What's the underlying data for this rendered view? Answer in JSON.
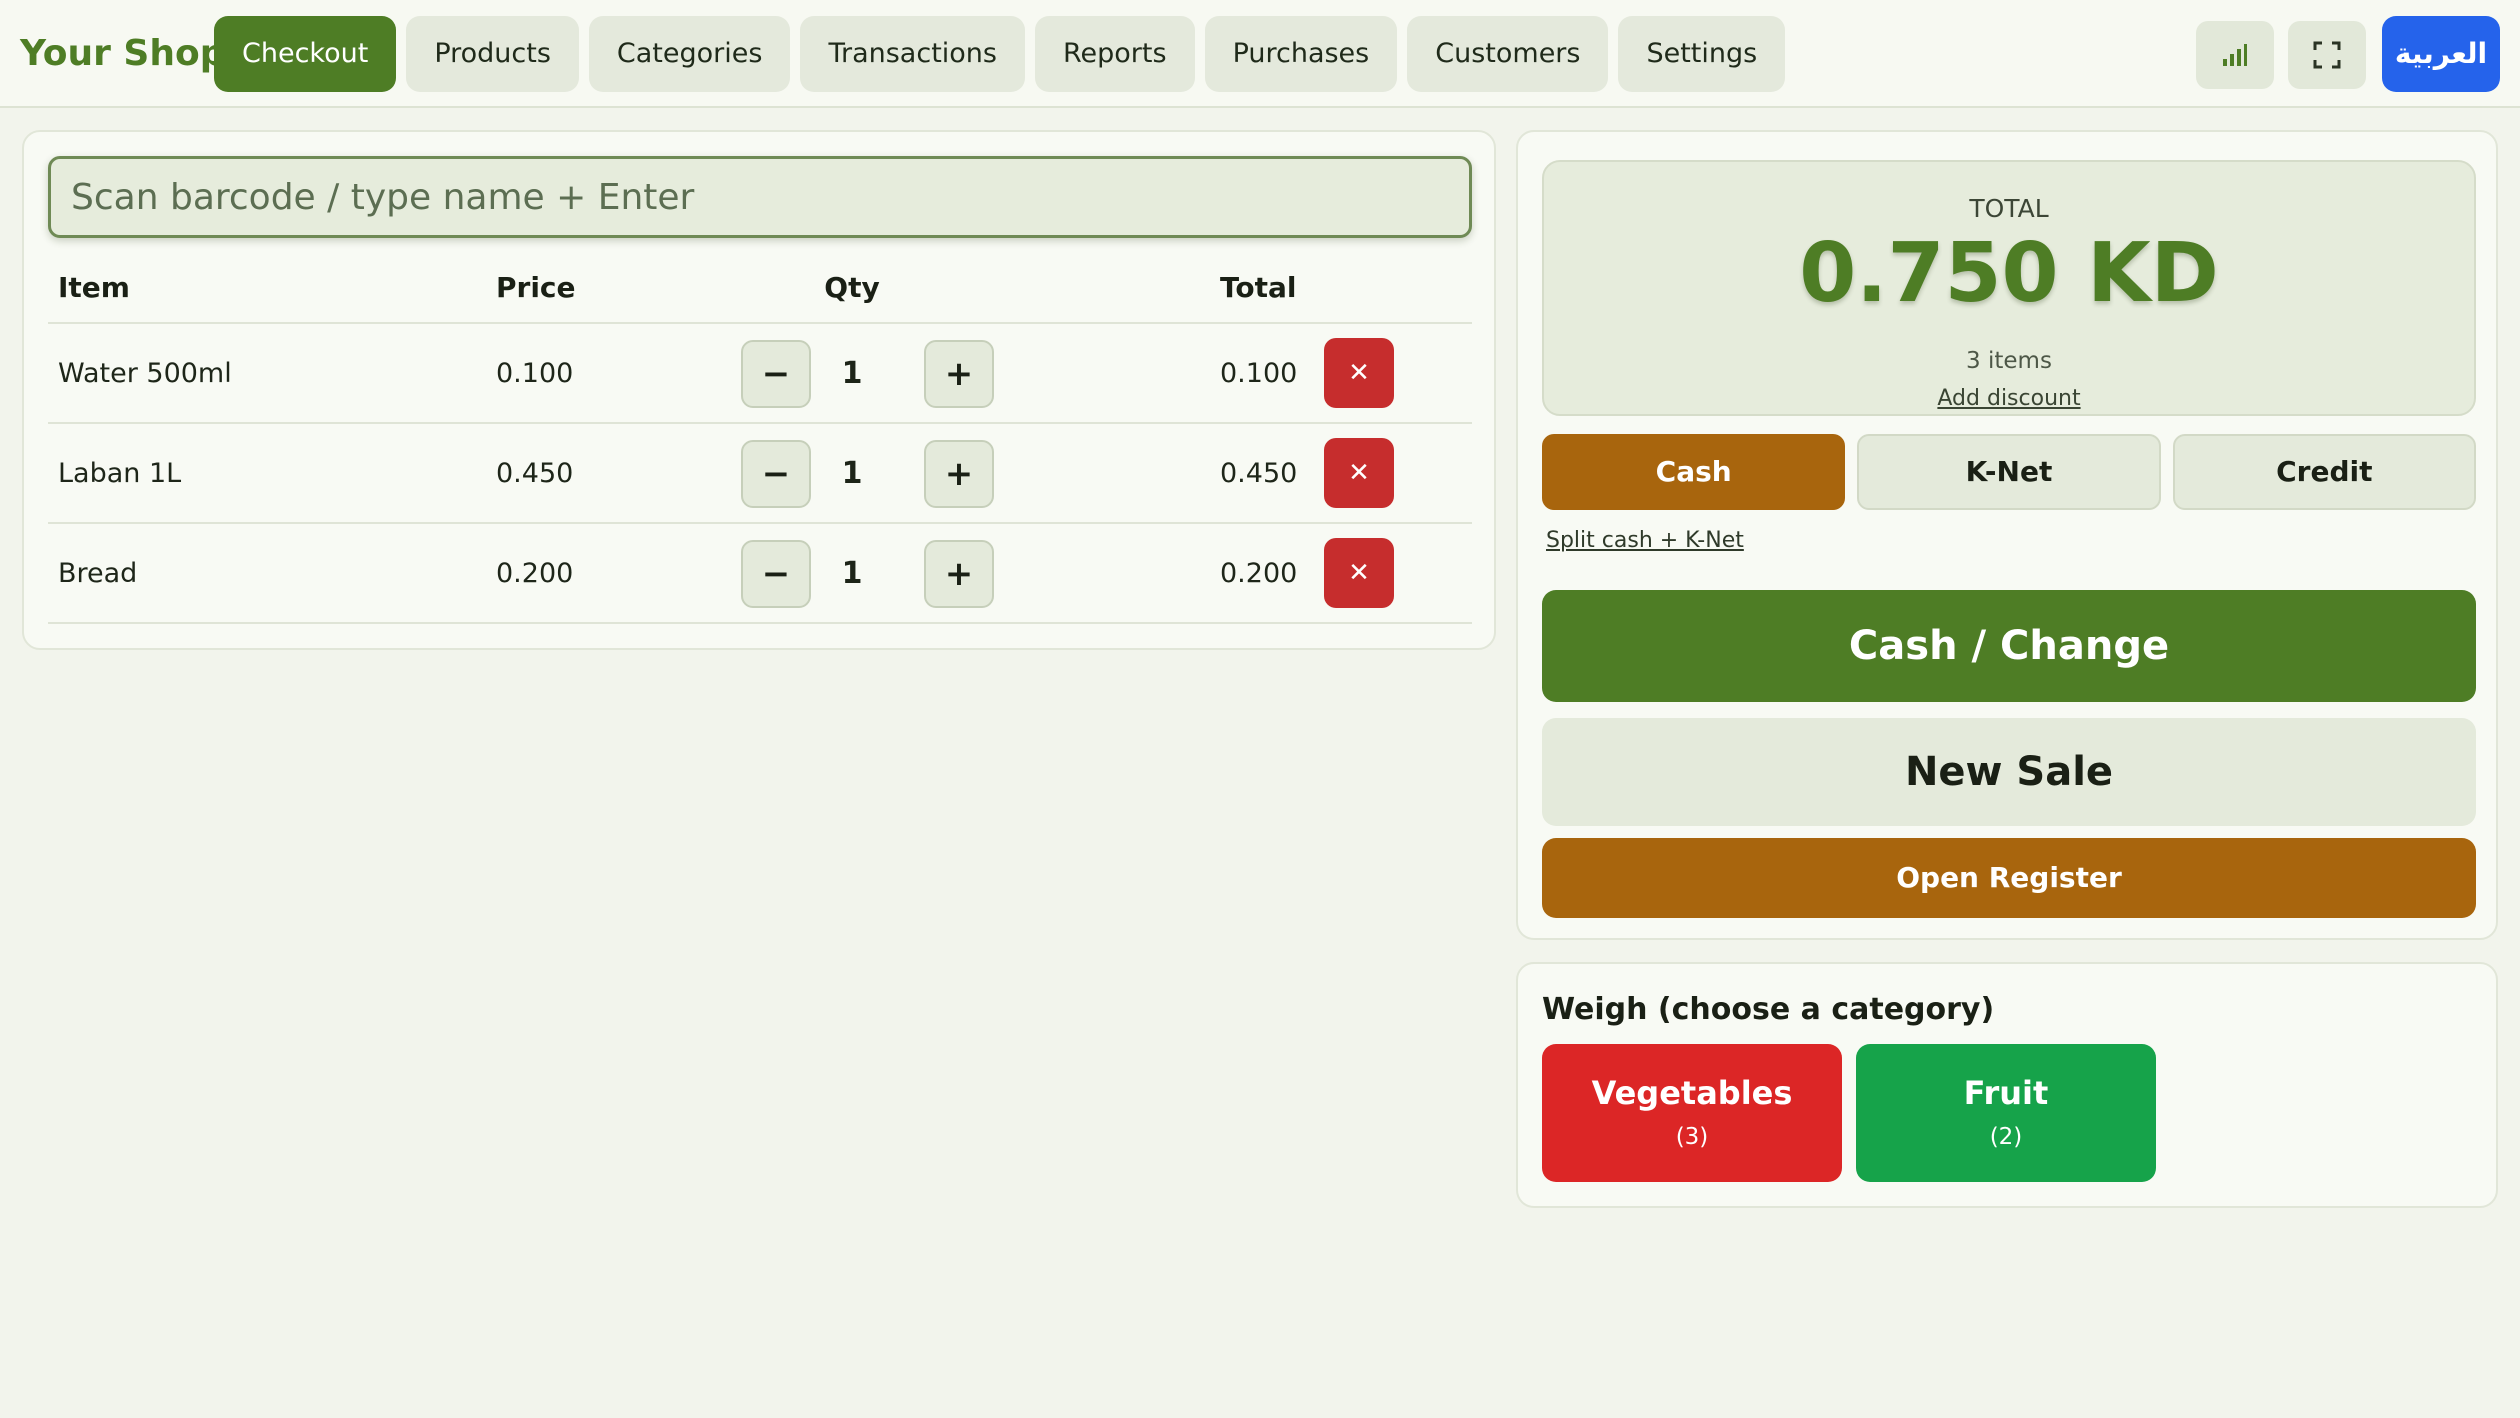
{
  "app": {
    "brand": "Your Shop",
    "accent_color": "#4e7d25",
    "lang_button": "العربية"
  },
  "nav": {
    "tabs": [
      {
        "label": "Checkout",
        "active": true
      },
      {
        "label": "Products",
        "active": false
      },
      {
        "label": "Categories",
        "active": false
      },
      {
        "label": "Transactions",
        "active": false
      },
      {
        "label": "Reports",
        "active": false
      },
      {
        "label": "Purchases",
        "active": false
      },
      {
        "label": "Customers",
        "active": false
      },
      {
        "label": "Settings",
        "active": false
      }
    ],
    "icons": [
      "bar-chart-icon",
      "fullscreen-icon"
    ]
  },
  "scan": {
    "placeholder": "Scan barcode / type name + Enter",
    "value": ""
  },
  "cart": {
    "headers": {
      "item": "Item",
      "price": "Price",
      "qty": "Qty",
      "total": "Total"
    },
    "rows": [
      {
        "item": "Water 500ml",
        "price": "0.100",
        "qty": "1",
        "total": "0.100"
      },
      {
        "item": "Laban 1L",
        "price": "0.450",
        "qty": "1",
        "total": "0.450"
      },
      {
        "item": "Bread",
        "price": "0.200",
        "qty": "1",
        "total": "0.200"
      }
    ],
    "minus_symbol": "−",
    "plus_symbol": "+",
    "remove_symbol": "✕"
  },
  "summary": {
    "total_label": "TOTAL",
    "total_amount": "0.750 KD",
    "item_count": "3 items",
    "add_discount": "Add discount"
  },
  "payment": {
    "methods": [
      {
        "label": "Cash",
        "selected": true
      },
      {
        "label": "K-Net",
        "selected": false
      },
      {
        "label": "Credit",
        "selected": false
      }
    ],
    "split_link": "Split cash + K-Net",
    "selected_color": "#a8650d"
  },
  "actions": {
    "cash_change": "Cash / Change",
    "new_sale": "New Sale",
    "open_register": "Open Register"
  },
  "weigh": {
    "title": "Weigh (choose a category)",
    "categories": [
      {
        "name": "Vegetables",
        "count": "(3)",
        "color": "#dc2626"
      },
      {
        "name": "Fruit",
        "count": "(2)",
        "color": "#16a34a"
      }
    ]
  }
}
